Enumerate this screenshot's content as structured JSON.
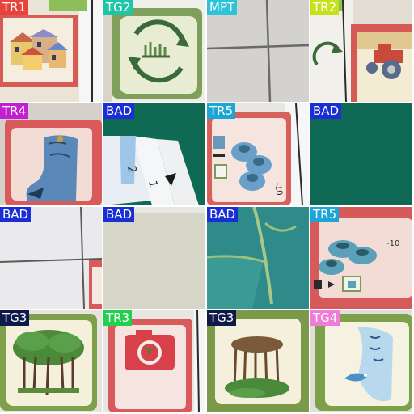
{
  "tiles": [
    {
      "label": "TR1",
      "label_bg": "#e8423c",
      "label_fg": "#ffffff"
    },
    {
      "label": "TG2",
      "label_bg": "#20c4a8",
      "label_fg": "#ffffff"
    },
    {
      "label": "MPT",
      "label_bg": "#2bc4d8",
      "label_fg": "#ffffff"
    },
    {
      "label": "TR2",
      "label_bg": "#c6e01a",
      "label_fg": "#ffffff"
    },
    {
      "label": "TR4",
      "label_bg": "#c21fd0",
      "label_fg": "#ffffff"
    },
    {
      "label": "BAD",
      "label_bg": "#1a2ed6",
      "label_fg": "#ffffff"
    },
    {
      "label": "TR5",
      "label_bg": "#1aa6d6",
      "label_fg": "#ffffff"
    },
    {
      "label": "BAD",
      "label_bg": "#1a2ed6",
      "label_fg": "#ffffff"
    },
    {
      "label": "BAD",
      "label_bg": "#1a2ed6",
      "label_fg": "#ffffff"
    },
    {
      "label": "BAD",
      "label_bg": "#1a2ed6",
      "label_fg": "#ffffff"
    },
    {
      "label": "BAD",
      "label_bg": "#1a2ed6",
      "label_fg": "#ffffff"
    },
    {
      "label": "TR5",
      "label_bg": "#1aa6d6",
      "label_fg": "#ffffff"
    },
    {
      "label": "TG3",
      "label_bg": "#0f1a4a",
      "label_fg": "#ffffff"
    },
    {
      "label": "TR3",
      "label_bg": "#22d050",
      "label_fg": "#ffffff"
    },
    {
      "label": "TG3",
      "label_bg": "#0f1a4a",
      "label_fg": "#ffffff"
    },
    {
      "label": "TG4",
      "label_bg": "#ef7bd8",
      "label_fg": "#ffffff"
    }
  ],
  "card_text": {
    "tile5_digits": [
      "2",
      "1"
    ],
    "tile6_number": "-10",
    "tile11_number": "-10"
  }
}
